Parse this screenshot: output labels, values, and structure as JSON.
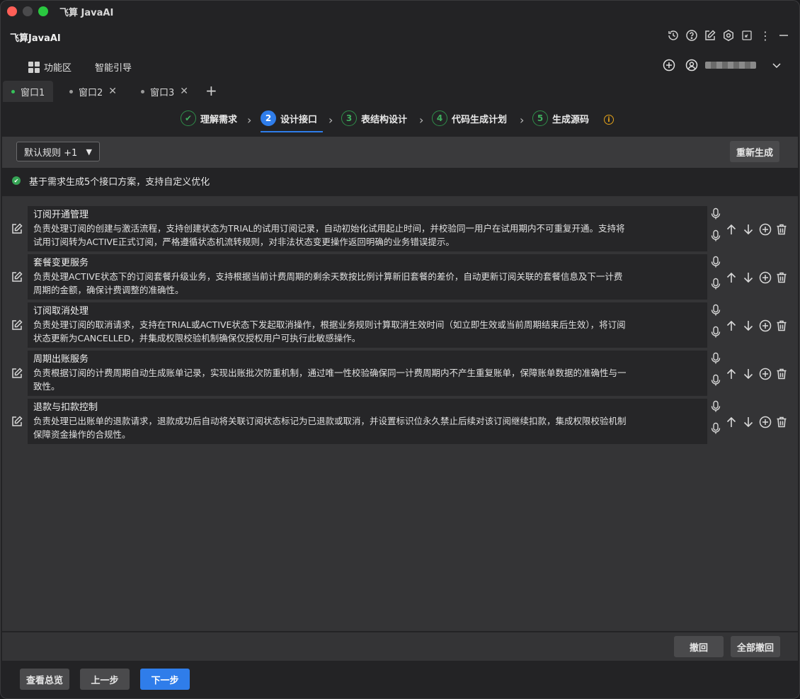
{
  "window": {
    "title": "飞算 JavaAI"
  },
  "app": {
    "name": "飞算JavaAI"
  },
  "menu": {
    "function_area": "功能区",
    "smart_guide": "智能引导"
  },
  "tabs": [
    {
      "label": "窗口1"
    },
    {
      "label": "窗口2"
    },
    {
      "label": "窗口3"
    }
  ],
  "steps": [
    {
      "number": "✔",
      "label": "理解需求"
    },
    {
      "number": "2",
      "label": "设计接口"
    },
    {
      "number": "3",
      "label": "表结构设计"
    },
    {
      "number": "4",
      "label": "代码生成计划"
    },
    {
      "number": "5",
      "label": "生成源码"
    }
  ],
  "toolbar": {
    "rule_select": "默认规则 +1",
    "regenerate": "重新生成"
  },
  "notice": {
    "text": "基于需求生成5个接口方案，支持自定义优化"
  },
  "items": [
    {
      "title": "订阅开通管理",
      "desc_line1": "负责处理订阅的创建与激活流程，支持创建状态为TRIAL的试用订阅记录，自动初始化试用起止时间，并校验同一用户在试用期内不可重复开通。支持将",
      "desc_line2": "试用订阅转为ACTIVE正式订阅，严格遵循状态机流转规则，对非法状态变更操作返回明确的业务错误提示。"
    },
    {
      "title": "套餐变更服务",
      "desc_line1": "负责处理ACTIVE状态下的订阅套餐升级业务，支持根据当前计费周期的剩余天数按比例计算新旧套餐的差价，自动更新订阅关联的套餐信息及下一计费",
      "desc_line2": "周期的金额，确保计费调整的准确性。"
    },
    {
      "title": "订阅取消处理",
      "desc_line1": "负责处理订阅的取消请求，支持在TRIAL或ACTIVE状态下发起取消操作，根据业务规则计算取消生效时间（如立即生效或当前周期结束后生效），将订阅",
      "desc_line2": "状态更新为CANCELLED，并集成权限校验机制确保仅授权用户可执行此敏感操作。"
    },
    {
      "title": "周期出账服务",
      "desc_line1": "负责根据订阅的计费周期自动生成账单记录，实现出账批次防重机制，通过唯一性校验确保同一计费周期内不产生重复账单，保障账单数据的准确性与一",
      "desc_line2": "致性。"
    },
    {
      "title": "退款与扣款控制",
      "desc_line1": "负责处理已出账单的退款请求，退款成功后自动将关联订阅状态标记为已退款或取消，并设置标识位永久禁止后续对该订阅继续扣款，集成权限校验机制",
      "desc_line2": "保障资金操作的合规性。"
    }
  ],
  "footer": {
    "undo": "撤回",
    "undo_all": "全部撤回"
  },
  "bottom": {
    "overview": "查看总览",
    "prev": "上一步",
    "next": "下一步"
  },
  "colors": {
    "accent": "#2f7dea",
    "success": "#36a455",
    "warning": "#e3a21a"
  }
}
